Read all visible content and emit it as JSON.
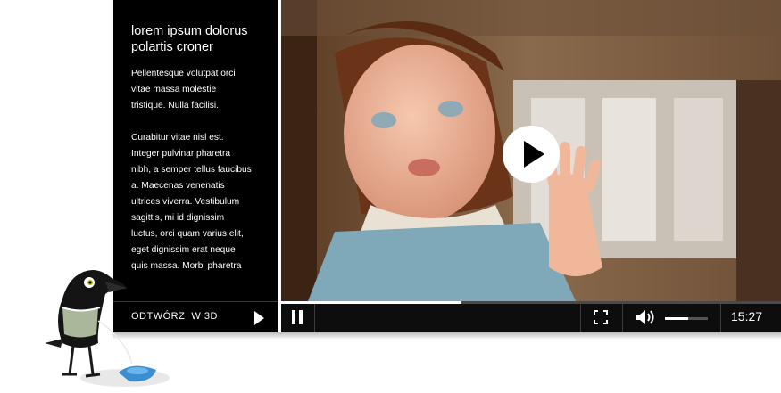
{
  "panel": {
    "title": "lorem ipsum dolorus\npolartis croner",
    "text": "Pellentesque volutpat orci\nvitae massa molestie\ntristique. Nulla facilisi.\n\nCurabitur vitae nisl est.\nInteger pulvinar pharetra\nnibh, a semper tellus faucibus\na. Maecenas venenatis\nultrices viverra. Vestibulum\nsagittis, mi id dignissim\nluctus, orci quam varius elit,\neget dignissim erat neque\nquis massa. Morbi pharetra"
  },
  "play3d": {
    "label": "ODTWÓRZ  W 3D",
    "icon": "play-arrow-icon"
  },
  "player": {
    "progress_fraction": 0.36,
    "volume_fraction": 0.55,
    "time": "15:27",
    "icons": [
      "play-icon",
      "pause-icon",
      "fullscreen-icon",
      "volume-icon"
    ]
  },
  "colors": {
    "panel_bg": "#000000",
    "controls_bg": "#0d0d0d",
    "accent": "#ffffff"
  }
}
